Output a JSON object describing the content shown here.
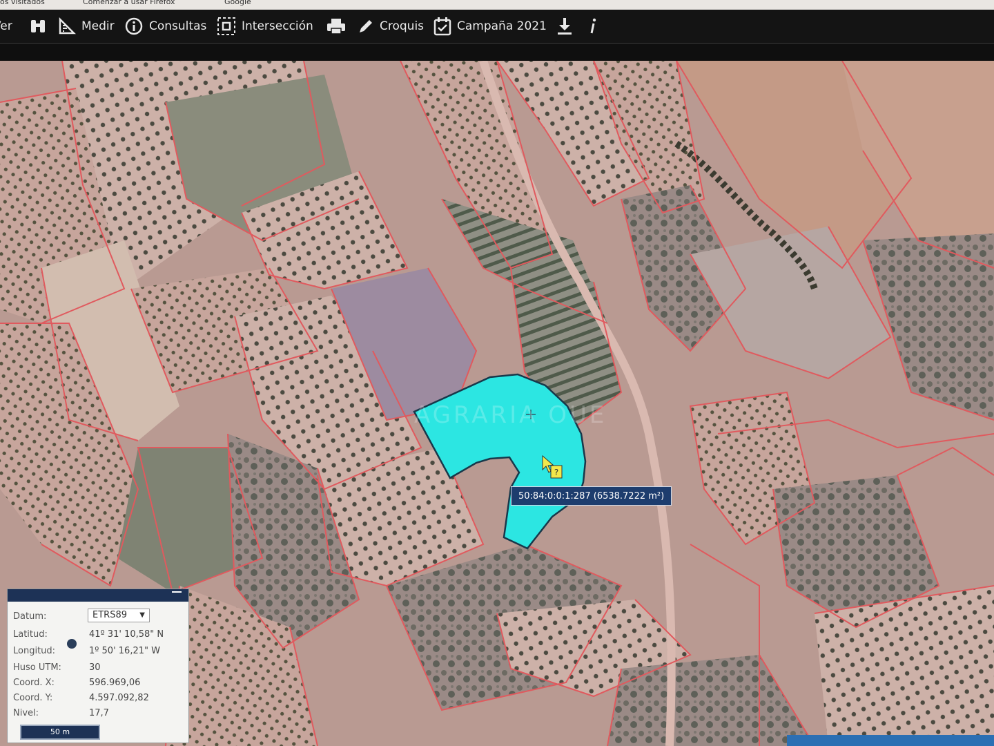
{
  "browser": {
    "bookmarks": [
      "os visitados",
      "Comenzar a usar Firefox",
      "Google"
    ]
  },
  "toolbar": {
    "items": [
      {
        "label": "Ver",
        "icon": "ver-icon"
      },
      {
        "label": "",
        "icon": "binoculars-icon"
      },
      {
        "label": "Medir",
        "icon": "ruler-icon"
      },
      {
        "label": "Consultas",
        "icon": "info-circle-icon"
      },
      {
        "label": "Intersección",
        "icon": "intersection-icon"
      },
      {
        "label": "",
        "icon": "printer-icon"
      },
      {
        "label": "Croquis",
        "icon": "pencil-icon"
      },
      {
        "label": "Campaña 2021",
        "icon": "calendar-check-icon"
      },
      {
        "label": "",
        "icon": "download-icon"
      },
      {
        "label": "",
        "icon": "info-icon"
      }
    ]
  },
  "map": {
    "selected_parcel_color": "#2ce6e2",
    "parcel_border_color": "#e05a5e",
    "tooltip": "50:84:0:0:1:287 (6538.7222 m²)",
    "watermark": "AGRARIA OUE",
    "cursor_help": "?"
  },
  "coord_panel": {
    "datum_label": "Datum:",
    "datum_value": "ETRS89",
    "rows": [
      {
        "label": "Latitud:",
        "value": "41º 31' 10,58\" N"
      },
      {
        "label": "Longitud:",
        "value": "1º 50' 16,21\" W"
      },
      {
        "label": "Huso UTM:",
        "value": "30"
      },
      {
        "label": "Coord. X:",
        "value": "596.969,06"
      },
      {
        "label": "Coord. Y:",
        "value": "4.597.092,82"
      },
      {
        "label": "Nivel:",
        "value": "17,7"
      }
    ],
    "scale": "50 m"
  },
  "colors": {
    "toolbar_bg": "#141414",
    "panel_header": "#1d3256",
    "tooltip_bg": "#1d3d6e"
  }
}
